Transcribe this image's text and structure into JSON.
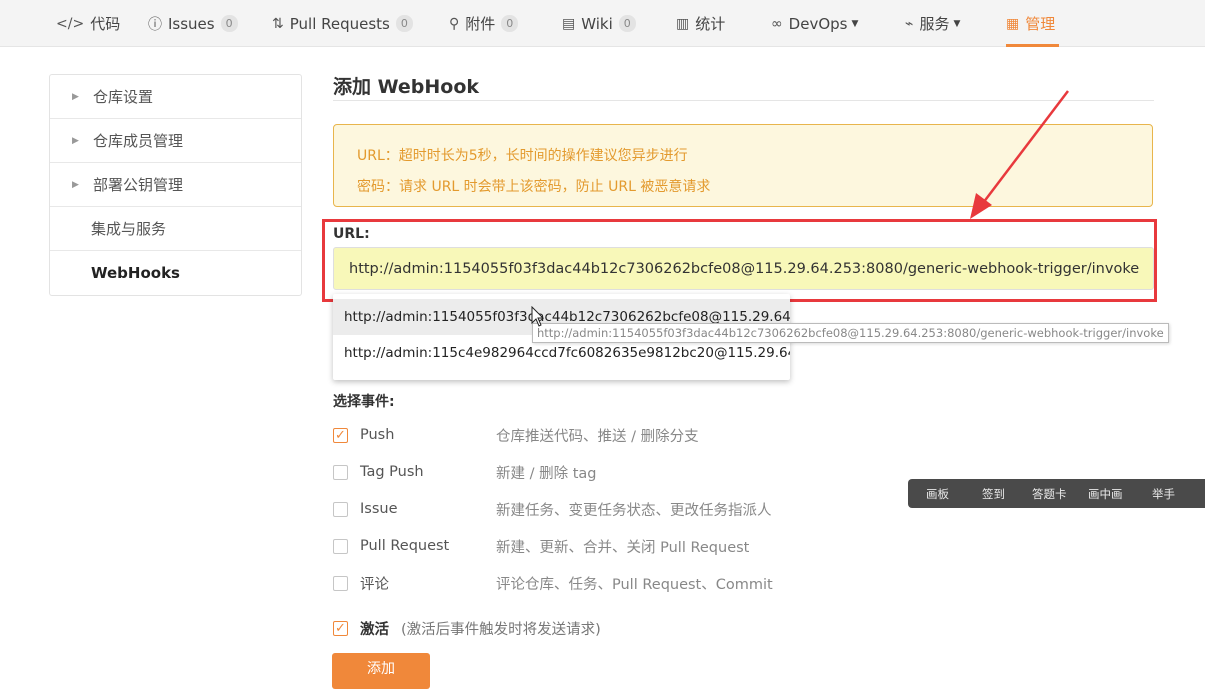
{
  "nav": {
    "items": [
      {
        "icon": "code-icon",
        "glyph": "</>",
        "label": "代码"
      },
      {
        "icon": "issue-icon",
        "glyph": "ⓘ",
        "label": "Issues",
        "count": "0"
      },
      {
        "icon": "pull-request-icon",
        "glyph": "⇅",
        "label": "Pull Requests",
        "count": "0"
      },
      {
        "icon": "attachment-icon",
        "glyph": "⚲",
        "label": "附件",
        "count": "0"
      },
      {
        "icon": "wiki-icon",
        "glyph": "▤",
        "label": "Wiki",
        "count": "0"
      },
      {
        "icon": "stats-icon",
        "glyph": "▥",
        "label": "统计"
      },
      {
        "icon": "devops-icon",
        "glyph": "∞",
        "label": "DevOps"
      },
      {
        "icon": "services-icon",
        "glyph": "⌁",
        "label": "服务"
      },
      {
        "icon": "manage-icon",
        "glyph": "▦",
        "label": "管理"
      }
    ],
    "active_color": "#f0883a"
  },
  "sidebar": {
    "items": [
      {
        "label": "仓库设置"
      },
      {
        "label": "仓库成员管理"
      },
      {
        "label": "部署公钥管理"
      },
      {
        "label": "集成与服务"
      },
      {
        "label": "WebHooks"
      }
    ]
  },
  "main": {
    "title": "添加 WebHook",
    "notice": {
      "line1": "URL：超时时长为5秒，长时间的操作建议您异步进行",
      "line2": "密码：请求 URL 时会带上该密码，防止 URL 被恶意请求"
    },
    "url": {
      "label": "URL:",
      "value": "http://admin:1154055f03f3dac44b12c7306262bcfe08@115.29.64.253:8080/generic-webhook-trigger/invoke"
    },
    "autocomplete": {
      "options": [
        "http://admin:1154055f03f3dac44b12c7306262bcfe08@115.29.64.2...",
        "http://admin:115c4e982964ccd7fc6082635e9812bc20@115.29.64.2..."
      ],
      "tooltip": "http://admin:1154055f03f3dac44b12c7306262bcfe08@115.29.64.253:8080/generic-webhook-trigger/invoke"
    },
    "events_label": "选择事件:",
    "events": [
      {
        "name": "Push",
        "desc": "仓库推送代码、推送 / 删除分支",
        "checked": true
      },
      {
        "name": "Tag Push",
        "desc": "新建 / 删除 tag",
        "checked": false
      },
      {
        "name": "Issue",
        "desc": "新建任务、变更任务状态、更改任务指派人",
        "checked": false
      },
      {
        "name": "Pull Request",
        "desc": "新建、更新、合并、关闭 Pull Request",
        "checked": false
      },
      {
        "name": "评论",
        "desc": "评论仓库、任务、Pull Request、Commit",
        "checked": false
      }
    ],
    "activate": {
      "label": "激活",
      "note": "(激活后事件触发时将发送请求)",
      "checked": true
    },
    "submit_label": "添加"
  },
  "toolbar": {
    "items": [
      "画板",
      "签到",
      "答题卡",
      "画中画",
      "举手"
    ]
  },
  "colors": {
    "accent": "#f0883a",
    "highlight_box": "#e8393d",
    "notice_bg": "#fdf7de",
    "url_bg": "#f8f8b9"
  }
}
